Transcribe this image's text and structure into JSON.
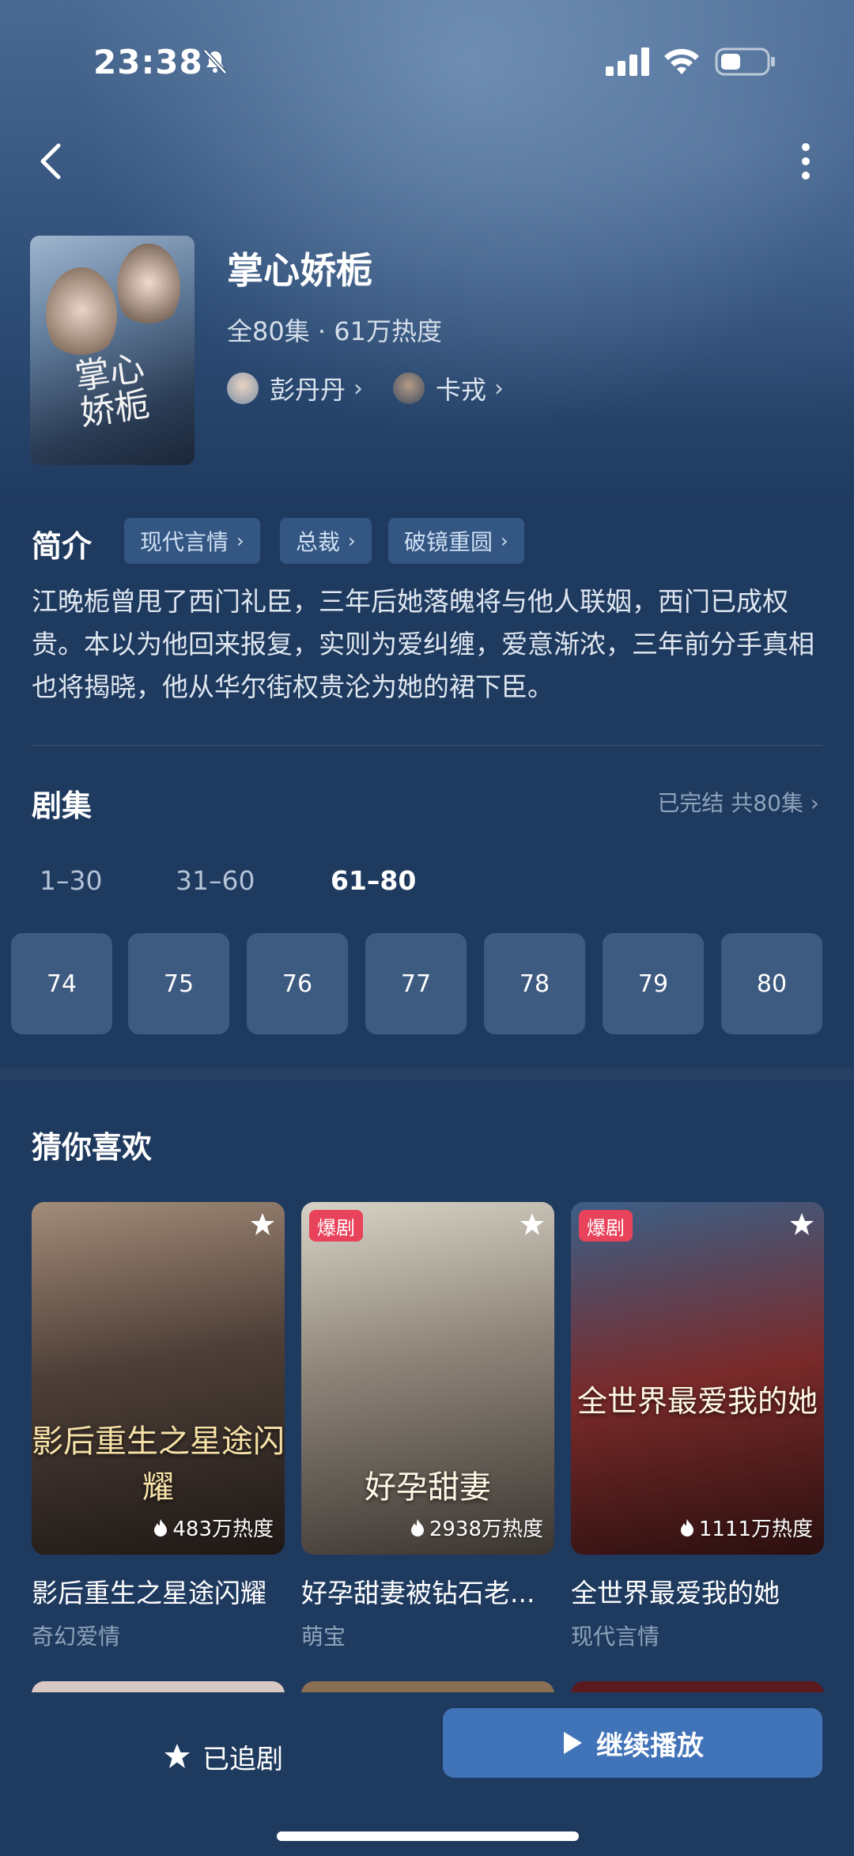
{
  "status_bar": {
    "time": "23:38"
  },
  "drama": {
    "title": "掌心娇栀",
    "meta": "全80集 · 61万热度",
    "actors": [
      {
        "name": "彭丹丹"
      },
      {
        "name": "卡戎"
      }
    ]
  },
  "intro": {
    "label": "简介",
    "tags": [
      "现代言情",
      "总裁",
      "破镜重圆"
    ],
    "text": "江晚栀曾甩了西门礼臣，三年后她落魄将与他人联姻，西门已成权贵。本以为他回来报复，实则为爱纠缠，爱意渐浓，三年前分手真相也将揭晓，他从华尔街权贵沦为她的裙下臣。"
  },
  "episodes": {
    "label": "剧集",
    "status": "已完结 共80集",
    "ranges": [
      "1–30",
      "31–60",
      "61–80"
    ],
    "active_range": "61–80",
    "items": [
      "74",
      "75",
      "76",
      "77",
      "78",
      "79",
      "80"
    ]
  },
  "recommend": {
    "label": "猜你喜欢",
    "cards": [
      {
        "name": "影后重生之星途闪耀",
        "genre": "奇幻爱情",
        "heat": "483万热度",
        "badge": "",
        "overlay": "影后重生之星途闪耀"
      },
      {
        "name": "好孕甜妻被钻石老...",
        "genre": "萌宝",
        "heat": "2938万热度",
        "badge": "爆剧",
        "overlay": "好孕甜妻"
      },
      {
        "name": "全世界最爱我的她",
        "genre": "现代言情",
        "heat": "1111万热度",
        "badge": "爆剧",
        "overlay": "全世界最爱我的她"
      }
    ]
  },
  "bottom": {
    "follow_label": "已追剧",
    "play_label": "继续播放"
  }
}
